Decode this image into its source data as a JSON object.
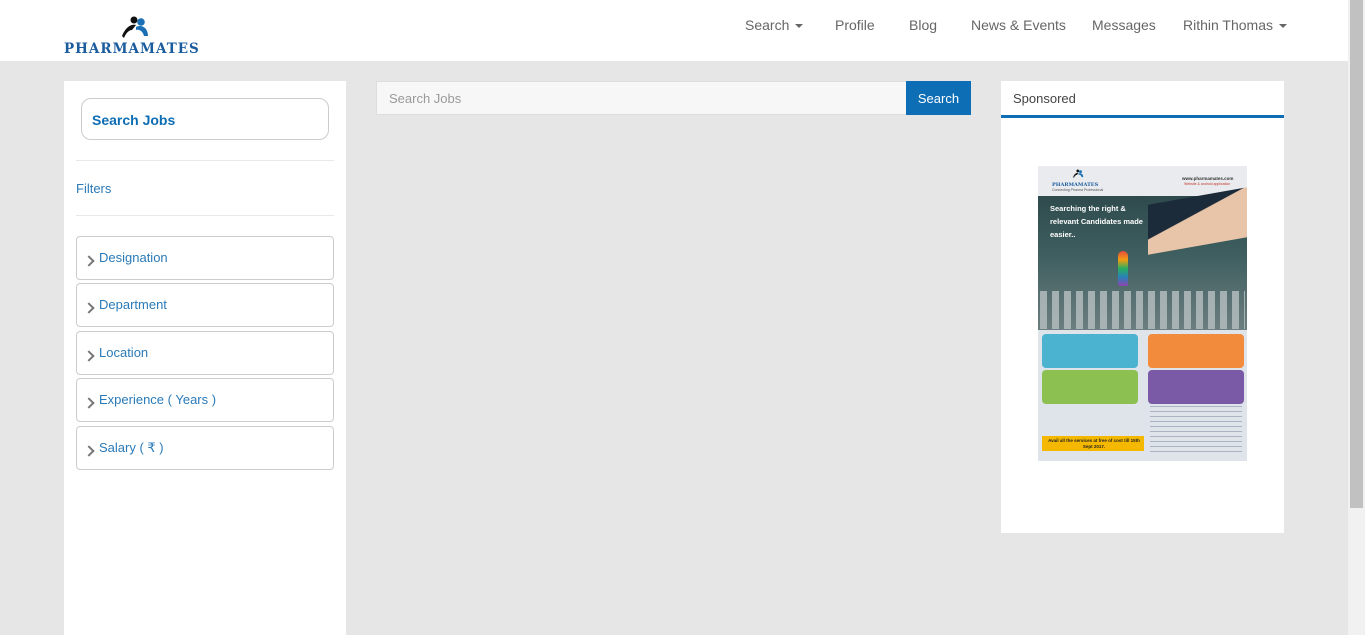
{
  "brand": {
    "name": "PHARMAMATES"
  },
  "nav": {
    "items": [
      {
        "label": "Search",
        "dropdown": true
      },
      {
        "label": "Profile",
        "dropdown": false
      },
      {
        "label": "Blog",
        "dropdown": false
      },
      {
        "label": "News & Events",
        "dropdown": false
      },
      {
        "label": "Messages",
        "dropdown": false
      },
      {
        "label": "Rithin Thomas",
        "dropdown": true
      }
    ]
  },
  "sidebar": {
    "search_button": "Search Jobs",
    "filters_label": "Filters",
    "filters": [
      {
        "label": "Designation"
      },
      {
        "label": "Department"
      },
      {
        "label": "Location"
      },
      {
        "label": "Experience ( Years )"
      },
      {
        "label": "Salary ( ₹ )"
      }
    ]
  },
  "search": {
    "placeholder": "Search Jobs",
    "value": "",
    "button_label": "Search"
  },
  "sponsored": {
    "title": "Sponsored",
    "ad": {
      "logo_text": "PHARMAMATES",
      "logo_sub": "Connecting Pharma Professional",
      "url": "www.pharmamates.com",
      "url_sub": "Website & android application",
      "headline": "Searching the right & relevant Candidates made easier..",
      "banner": "Avail all the services at free of cost till 15th Sept 2017."
    }
  },
  "colors": {
    "accent": "#0d6eb5",
    "link": "#2a7ab8",
    "page_bg": "#e6e6e6"
  }
}
